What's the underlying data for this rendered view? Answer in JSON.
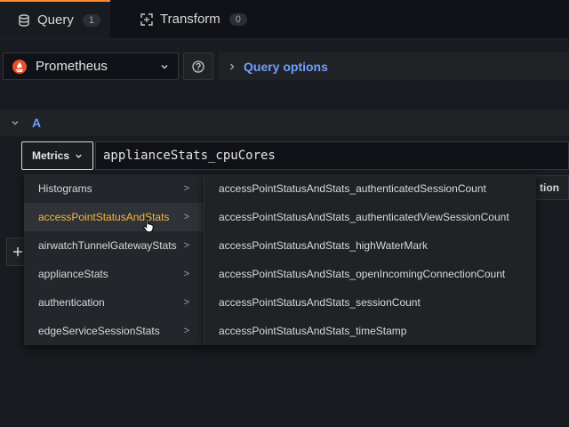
{
  "tabs": [
    {
      "label": "Query",
      "count": "1",
      "icon": "database-icon"
    },
    {
      "label": "Transform",
      "count": "0",
      "icon": "transform-icon"
    }
  ],
  "datasource": {
    "name": "Prometheus",
    "icon": "prometheus-icon"
  },
  "help": {
    "icon": "question-circle-icon"
  },
  "query_options": {
    "label": "Query options"
  },
  "query": {
    "ref": "A"
  },
  "metrics_button": {
    "label": "Metrics"
  },
  "expression": {
    "value": "applianceStats_cpuCores"
  },
  "options_button": {
    "label": "tion"
  },
  "cascader": {
    "level1": [
      {
        "label": "Histograms"
      },
      {
        "label": "accessPointStatusAndStats",
        "active": true
      },
      {
        "label": "airwatchTunnelGatewayStats"
      },
      {
        "label": "applianceStats"
      },
      {
        "label": "authentication"
      },
      {
        "label": "edgeServiceSessionStats"
      }
    ],
    "arrow": ">",
    "level2": [
      {
        "label": "accessPointStatusAndStats_authenticatedSessionCount"
      },
      {
        "label": "accessPointStatusAndStats_authenticatedViewSessionCount"
      },
      {
        "label": "accessPointStatusAndStats_highWaterMark"
      },
      {
        "label": "accessPointStatusAndStats_openIncomingConnectionCount"
      },
      {
        "label": "accessPointStatusAndStats_sessionCount"
      },
      {
        "label": "accessPointStatusAndStats_timeStamp"
      }
    ]
  },
  "colors": {
    "accent": "#ff8833",
    "link": "#6e9fff",
    "highlight": "#f5b73d"
  }
}
